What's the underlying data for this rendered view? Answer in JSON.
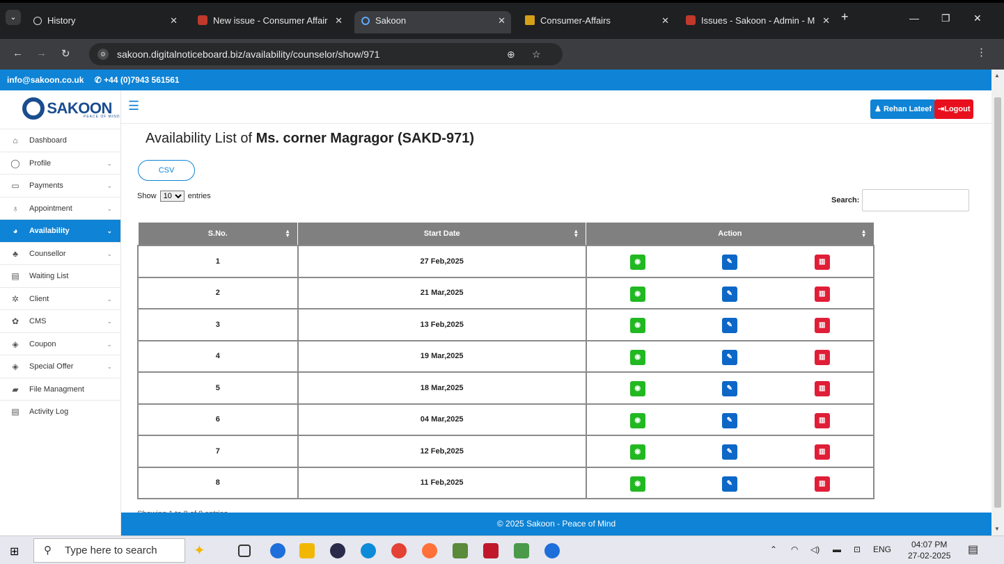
{
  "browser": {
    "tabs": [
      {
        "title": "History",
        "icon": "history-icon",
        "active": false
      },
      {
        "title": "New issue - Consumer Affair",
        "icon": "github-icon",
        "active": false
      },
      {
        "title": "Sakoon",
        "icon": "sakoon-icon",
        "active": true
      },
      {
        "title": "Consumer-Affairs",
        "icon": "consumer-icon",
        "active": false
      },
      {
        "title": "Issues - Sakoon - Admin - M",
        "icon": "github-icon",
        "active": false
      }
    ],
    "new_tab_label": "+",
    "url": "sakoon.digitalnoticeboard.biz/availability/counselor/show/971"
  },
  "site": {
    "email": "info@sakoon.co.uk",
    "phone": "+44 (0)7943 561561",
    "logo_text": "SAKOON",
    "logo_tagline": "PEACE OF MIND",
    "user_name": "Rehan Lateef",
    "logout_label": "Logout",
    "footer": "© 2025 Sakoon - Peace of Mind"
  },
  "sidebar": {
    "items": [
      {
        "label": "Dashboard",
        "icon": "home-icon",
        "has_children": false,
        "active": false
      },
      {
        "label": "Profile",
        "icon": "user-icon",
        "has_children": true,
        "active": false
      },
      {
        "label": "Payments",
        "icon": "money-icon",
        "has_children": true,
        "active": false
      },
      {
        "label": "Appointment",
        "icon": "stethoscope-icon",
        "has_children": true,
        "active": false
      },
      {
        "label": "Availability",
        "icon": "calendar-icon",
        "has_children": true,
        "active": true
      },
      {
        "label": "Counsellor",
        "icon": "people-icon",
        "has_children": true,
        "active": false
      },
      {
        "label": "Waiting List",
        "icon": "document-icon",
        "has_children": false,
        "active": false
      },
      {
        "label": "Client",
        "icon": "group-icon",
        "has_children": true,
        "active": false
      },
      {
        "label": "CMS",
        "icon": "gear-icon",
        "has_children": true,
        "active": false
      },
      {
        "label": "Coupon",
        "icon": "tag-icon",
        "has_children": true,
        "active": false
      },
      {
        "label": "Special Offer",
        "icon": "tag-icon",
        "has_children": true,
        "active": false
      },
      {
        "label": "File Managment",
        "icon": "folder-icon",
        "has_children": false,
        "active": false
      },
      {
        "label": "Activity Log",
        "icon": "document-icon",
        "has_children": false,
        "active": false
      }
    ]
  },
  "main": {
    "heading_prefix": "Availability List of ",
    "heading_name": "Ms. corner Magragor (SAKD-971)",
    "csv_label": "CSV",
    "show_label": "Show",
    "entries_label": "entries",
    "page_length": "10",
    "search_label": "Search:",
    "search_value": "",
    "columns": [
      "S.No.",
      "Start Date",
      "Action"
    ],
    "rows": [
      {
        "sno": "1",
        "date": "27 Feb,2025"
      },
      {
        "sno": "2",
        "date": "21 Mar,2025"
      },
      {
        "sno": "3",
        "date": "13 Feb,2025"
      },
      {
        "sno": "4",
        "date": "19 Mar,2025"
      },
      {
        "sno": "5",
        "date": "18 Mar,2025"
      },
      {
        "sno": "6",
        "date": "04 Mar,2025"
      },
      {
        "sno": "7",
        "date": "12 Feb,2025"
      },
      {
        "sno": "8",
        "date": "11 Feb,2025"
      }
    ],
    "info_text": "Showing 1 to 8 of 8 entries"
  },
  "taskbar": {
    "search_placeholder": "Type here to search",
    "language": "ENG",
    "time": "04:07 PM",
    "date": "27-02-2025"
  },
  "colors": {
    "brand_blue": "#0f83d5",
    "logout_red": "#e8101d",
    "view_green": "#22b822",
    "edit_blue": "#0c67c7",
    "delete_red": "#e01e37",
    "table_header_gray": "#808080"
  }
}
